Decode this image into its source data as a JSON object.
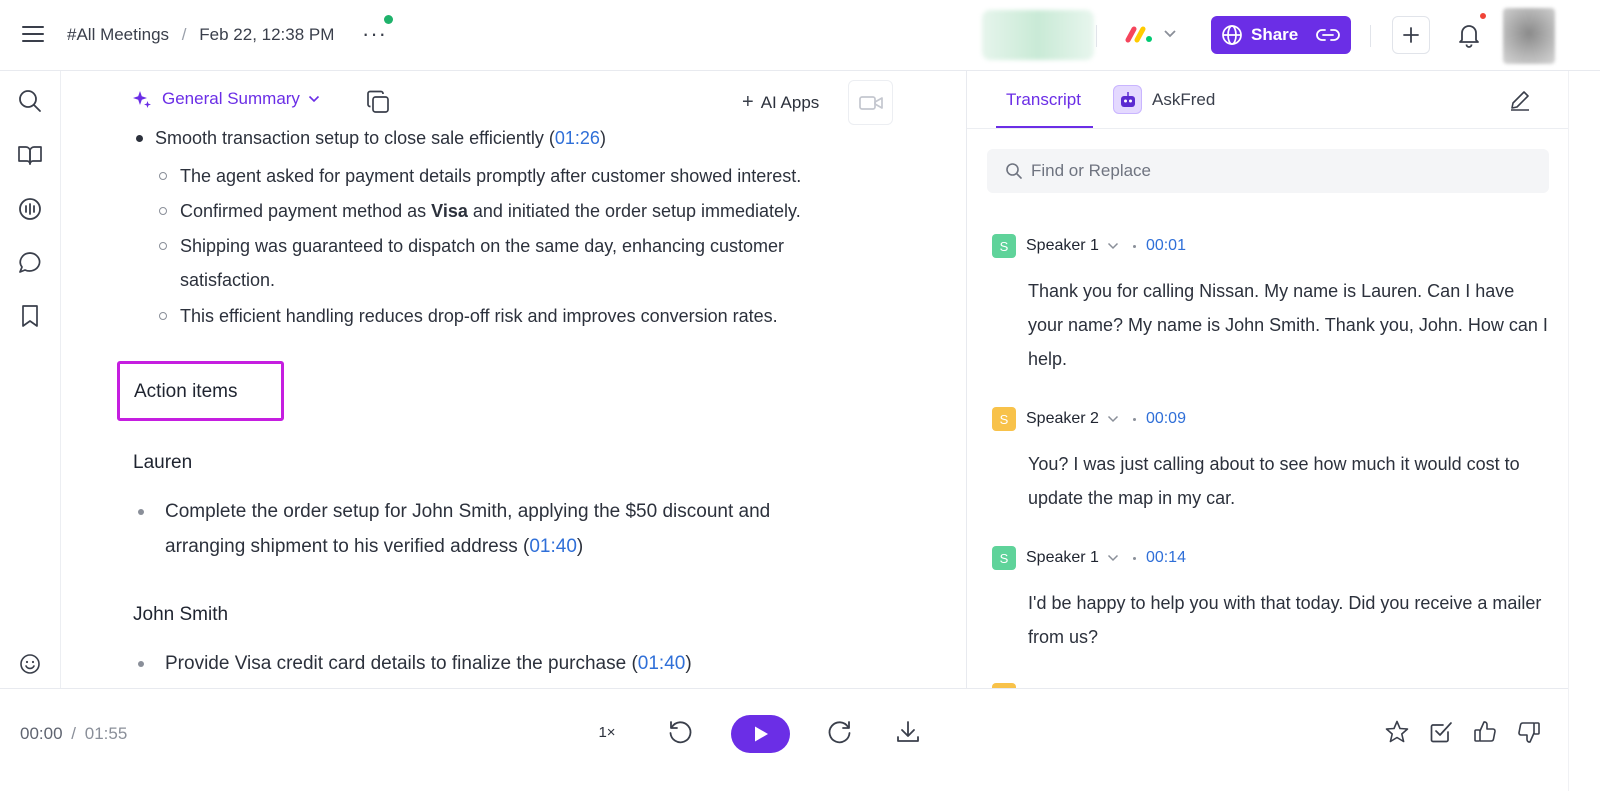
{
  "header": {
    "breadcrumb_root": "#All Meetings",
    "breadcrumb_sep": "/",
    "meeting_date": "Feb 22, 12:38 PM",
    "more_label": "···",
    "share_label": "Share"
  },
  "summary": {
    "view_label": "General Summary",
    "ai_apps_label": "AI Apps",
    "bullet_main_text": "Smooth transaction setup to close sale efficiently",
    "bullet_main_time": "01:26",
    "sub_items": [
      "The agent asked for payment details promptly after customer showed interest.",
      "Confirmed payment method as",
      "Visa",
      "and initiated the order setup immediately.",
      "Shipping was guaranteed to dispatch on the same day, enhancing customer",
      "satisfaction.",
      "This efficient handling reduces drop-off risk and improves conversion rates."
    ],
    "action_items_heading": "Action items",
    "assignees": [
      {
        "name": "Lauren",
        "line1": "Complete the order setup for John Smith, applying the $50 discount and",
        "line2": "arranging shipment to his verified address",
        "time": "01:40"
      },
      {
        "name": "John Smith",
        "line1": "Provide Visa credit card details to finalize the purchase",
        "time": "01:40"
      }
    ]
  },
  "transcript": {
    "tab_transcript": "Transcript",
    "tab_askfred": "AskFred",
    "search_placeholder": "Find or Replace",
    "segments": [
      {
        "badge": "S",
        "speaker": "Speaker 1",
        "time": "00:01",
        "text": "Thank you for calling Nissan. My name is Lauren. Can I have your name? My name is John Smith. Thank you, John. How can I help."
      },
      {
        "badge": "S",
        "speaker": "Speaker 2",
        "time": "00:09",
        "text": "You? I was just calling about to see how much it would cost to update the map in my car."
      },
      {
        "badge": "S",
        "speaker": "Speaker 1",
        "time": "00:14",
        "text": "I'd be happy to help you with that today. Did you receive a mailer from us?"
      }
    ]
  },
  "player": {
    "current_time": "00:00",
    "time_sep": "/",
    "total_time": "01:55",
    "speed": "1×"
  },
  "colors": {
    "accent": "#6b2ee6",
    "timestamp_link": "#2f6fd8",
    "highlight_border": "#c51ee0",
    "speaker1_badge": "#5fd39a",
    "speaker2_badge": "#f8c24a",
    "notification_dot": "#f04438",
    "status_dot": "#1fb26b"
  },
  "icons": {
    "menu": "hamburger-icon",
    "share": "globe-icon",
    "link": "link-icon",
    "add": "plus-icon",
    "notifications": "bell-icon",
    "rail": [
      "search-icon",
      "book-icon",
      "audio-icon",
      "chat-icon",
      "bookmark-icon",
      "smiley-icon"
    ],
    "player": [
      "rewind-icon",
      "play-icon",
      "forward-icon",
      "download-icon",
      "star-icon",
      "checkbox-icon",
      "thumbs-up-icon",
      "thumbs-down-icon"
    ]
  }
}
